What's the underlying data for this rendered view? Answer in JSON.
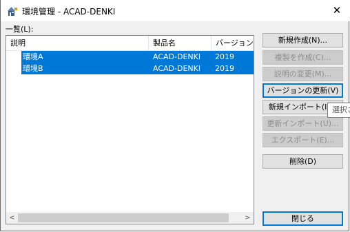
{
  "window": {
    "title": "環境管理 - ACAD-DENKI",
    "close_glyph": "✕"
  },
  "list": {
    "label": "一覧(L):",
    "columns": [
      "説明",
      "製品名",
      "バージョン"
    ],
    "rows": [
      {
        "description": "環境A",
        "product": "ACAD-DENKI",
        "version": "2019"
      },
      {
        "description": "環境B",
        "product": "ACAD-DENKI",
        "version": "2019"
      }
    ],
    "scroll_left": "<",
    "scroll_right": ">"
  },
  "buttons": {
    "new": "新規作成(N)...",
    "copy": "複製を作成(C)...",
    "change_desc": "説明の変更(M)...",
    "update_version": "バージョンの更新(V)",
    "new_import": "新規インポート(I)...",
    "update_import": "更新インポート(U)...",
    "export": "エクスポート(E)...",
    "delete": "削除(D)",
    "close": "閉じる"
  },
  "tooltip": "選択さ",
  "icons": {
    "app": "app-icon",
    "close": "close-icon"
  },
  "colors": {
    "selection": "#0078d7",
    "focus": "#0078d7"
  }
}
